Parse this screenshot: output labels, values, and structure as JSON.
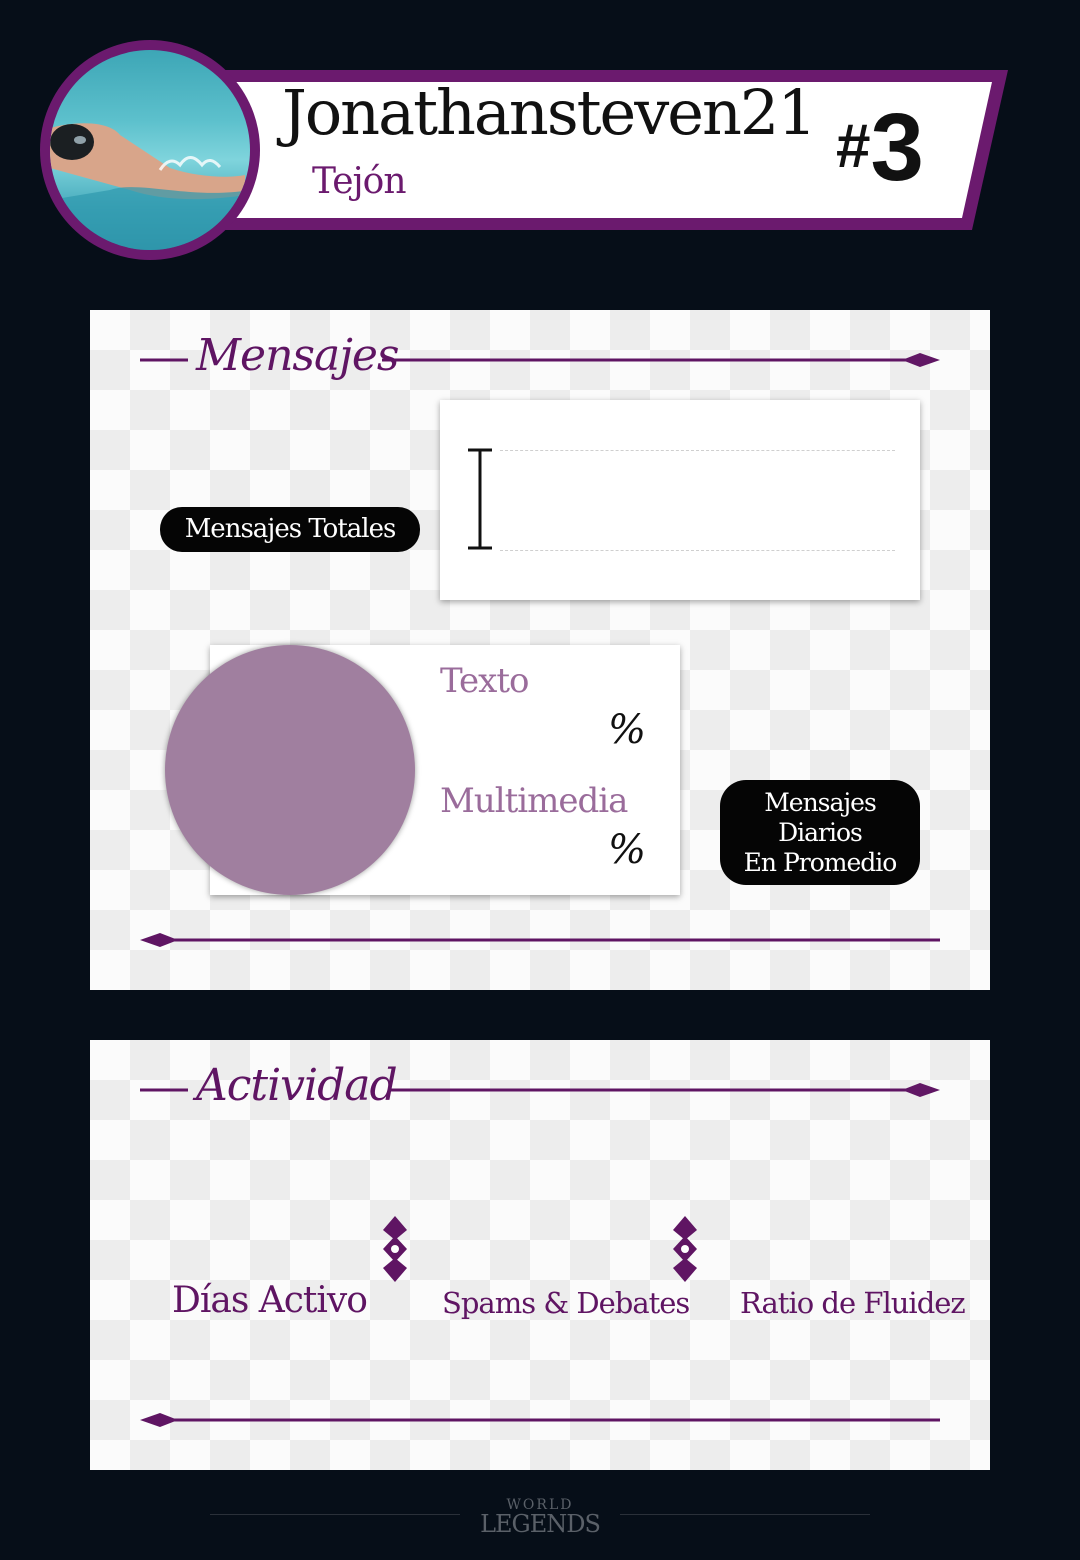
{
  "profile": {
    "username": "Jonathansteven21",
    "subtitle": "Tejón",
    "rank_hash": "#",
    "rank_number": "3"
  },
  "mensajes": {
    "title": "Mensajes",
    "totales_label": "Mensajes Totales",
    "texto_label": "Texto",
    "multimedia_label": "Multimedia",
    "percent_sign": "%",
    "diarios_line1": "Mensajes",
    "diarios_line2": "Diarios",
    "diarios_line3": "En Promedio"
  },
  "actividad": {
    "title": "Actividad",
    "dias_activo": "Días Activo",
    "spams_debates": "Spams & Debates",
    "ratio_fluidez": "Ratio de Fluidez"
  },
  "footer": {
    "logo_top": "WORLD",
    "logo_bottom": "LEGENDS"
  },
  "colors": {
    "accent": "#5f1563",
    "banner_border": "#6b1a6e",
    "pie": "#a07f9f",
    "background": "#060e18"
  }
}
